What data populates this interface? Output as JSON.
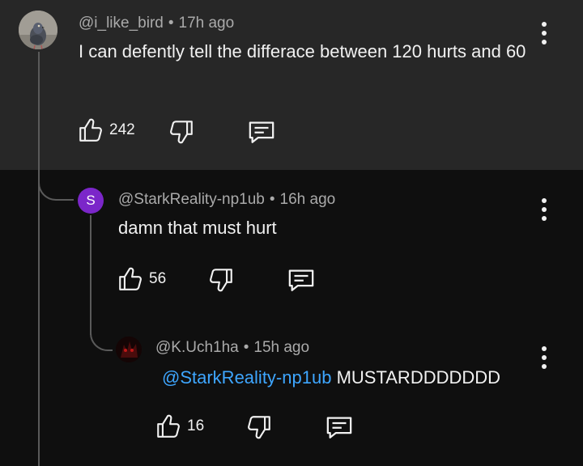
{
  "comments": [
    {
      "handle": "@i_like_bird",
      "separator": "•",
      "time": "17h ago",
      "text": "I can defently tell the differace between 120 hurts and 60",
      "likes": "242"
    },
    {
      "avatar_letter": "S",
      "handle": "@StarkReality-np1ub",
      "separator": "•",
      "time": "16h ago",
      "text": "damn that must hurt",
      "likes": "56"
    },
    {
      "handle": "@K.Uch1ha",
      "separator": "•",
      "time": "15h ago",
      "mention": "@StarkReality-np1ub",
      "text": "MUSTARDDDDDDD",
      "likes": "16"
    }
  ],
  "colors": {
    "top_background": "#272727",
    "page_background": "#0f0f0f",
    "mention": "#3ea6ff",
    "avatar_s": "#7b26c9"
  },
  "icons": [
    "pigeon-avatar",
    "like-icon",
    "dislike-icon",
    "reply-icon",
    "more-options-icon"
  ]
}
